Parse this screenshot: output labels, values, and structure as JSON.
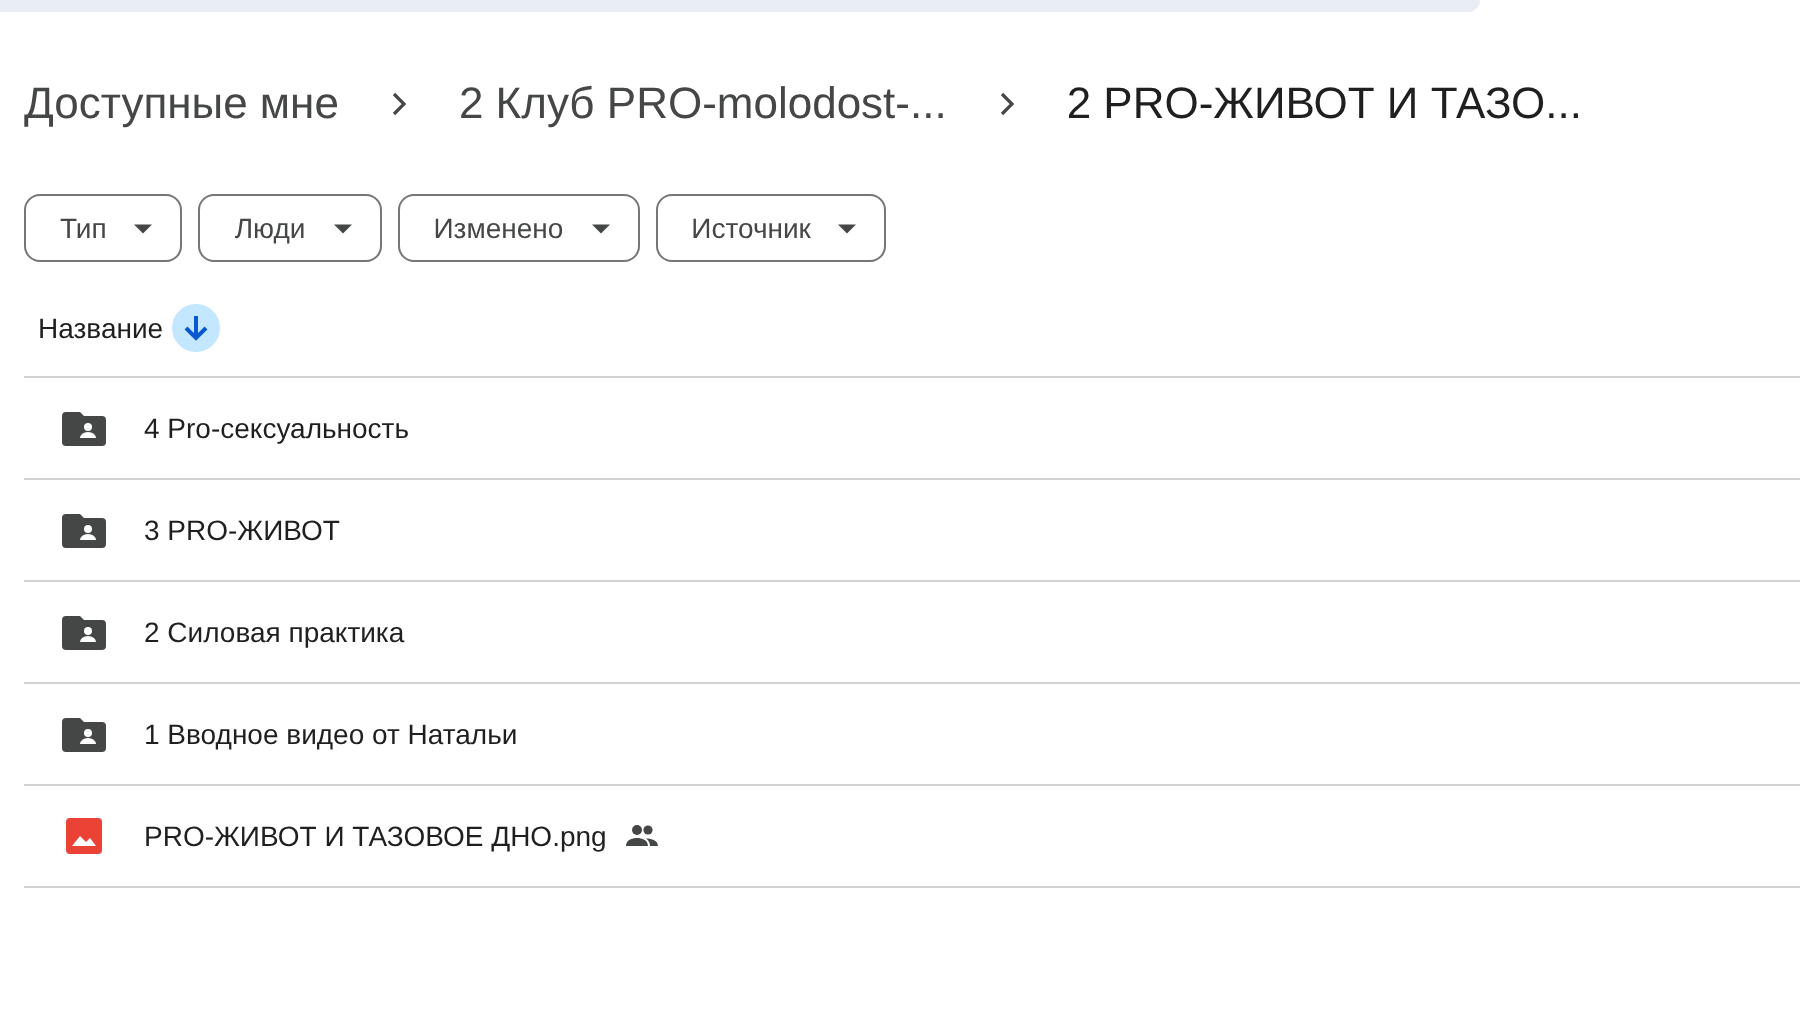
{
  "breadcrumbs": [
    {
      "label": "Доступные мне"
    },
    {
      "label": "2 Клуб PRO-molodost-..."
    },
    {
      "label": "2 PRO-ЖИВОТ И ТАЗО..."
    }
  ],
  "filters": [
    {
      "label": "Тип"
    },
    {
      "label": "Люди"
    },
    {
      "label": "Изменено"
    },
    {
      "label": "Источник"
    }
  ],
  "table": {
    "sort_column": "Название",
    "rows": [
      {
        "kind": "folder",
        "name": "4 Pro-сексуальность",
        "shared": false
      },
      {
        "kind": "folder",
        "name": "3 PRO-ЖИВОТ",
        "shared": false
      },
      {
        "kind": "folder",
        "name": "2 Силовая практика",
        "shared": false
      },
      {
        "kind": "folder",
        "name": "1 Вводное видео от Натальи",
        "shared": false
      },
      {
        "kind": "image",
        "name": "PRO-ЖИВОТ И ТАЗОВОЕ ДНО.png",
        "shared": true
      }
    ]
  }
}
